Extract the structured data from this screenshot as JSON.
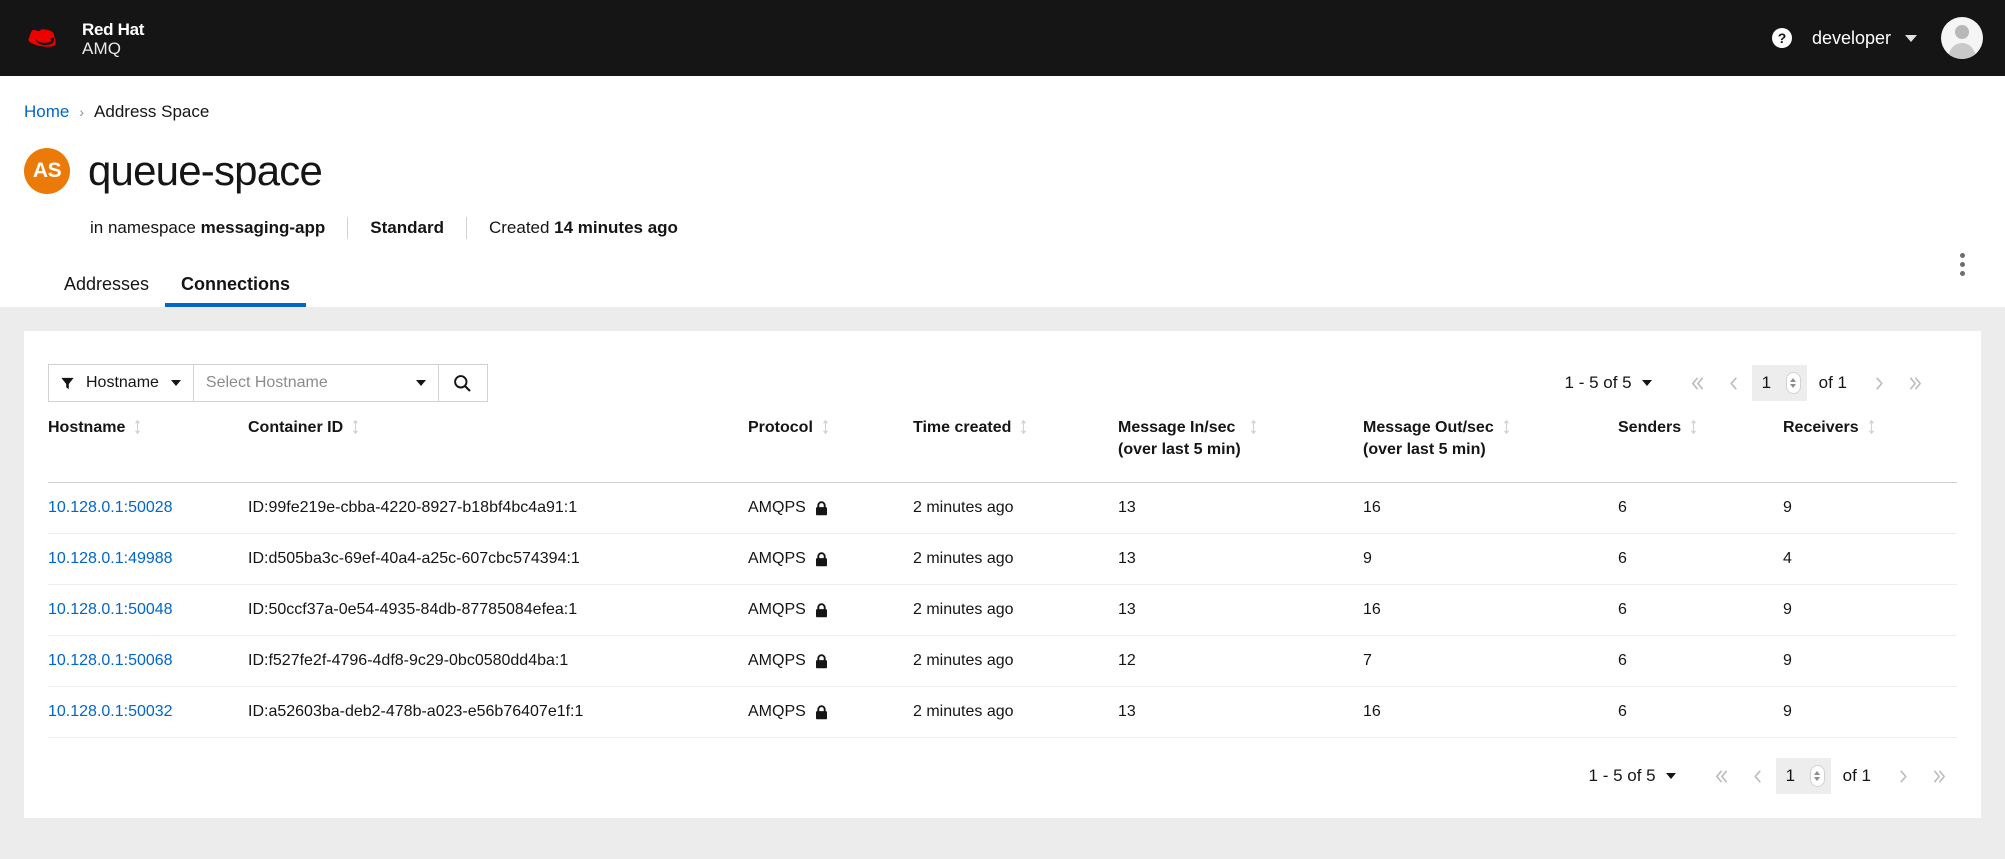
{
  "masthead": {
    "brand_line1": "Red Hat",
    "brand_line2": "AMQ",
    "help_icon": "question-circle-icon",
    "user_name": "developer",
    "avatar_icon": "user-avatar-icon"
  },
  "breadcrumb": {
    "home": "Home",
    "separator": "›",
    "current": "Address Space"
  },
  "page": {
    "badge": "AS",
    "title": "queue-space",
    "kebab_icon": "vertical-kebab-icon",
    "meta": {
      "namespace_prefix": "in namespace ",
      "namespace": "messaging-app",
      "plan": "Standard",
      "created_prefix": "Created ",
      "created": "14 minutes ago"
    }
  },
  "tabs": [
    {
      "label": "Addresses",
      "active": false
    },
    {
      "label": "Connections",
      "active": true
    }
  ],
  "toolbar": {
    "filter_icon": "filter-funnel-icon",
    "filter_label": "Hostname",
    "filter_caret_icon": "caret-down-icon",
    "typeahead_placeholder": "Select Hostname",
    "typeahead_value": "",
    "typeahead_caret_icon": "caret-down-icon",
    "search_icon": "search-icon"
  },
  "pagination": {
    "summary": "1 - 5 of 5",
    "summary_range": "1 - 5",
    "summary_total": "5",
    "summary_caret_icon": "caret-down-icon",
    "first_icon": "angle-double-left-icon",
    "prev_icon": "angle-left-icon",
    "page_value": "1",
    "spinner_icon": "number-spinner-icon",
    "of_label": "of 1",
    "next_icon": "angle-right-icon",
    "last_icon": "angle-double-right-icon"
  },
  "table": {
    "columns": [
      {
        "label": "Hostname",
        "sub": "",
        "sort_icon": "sort-icon"
      },
      {
        "label": "Container ID",
        "sub": "",
        "sort_icon": "sort-icon"
      },
      {
        "label": "Protocol",
        "sub": "",
        "sort_icon": "sort-icon"
      },
      {
        "label": "Time created",
        "sub": "",
        "sort_icon": "sort-icon"
      },
      {
        "label": "Message In/sec",
        "sub": "(over last 5 min)",
        "sort_icon": "sort-icon"
      },
      {
        "label": "Message Out/sec",
        "sub": "(over last 5 min)",
        "sort_icon": "sort-icon"
      },
      {
        "label": "Senders",
        "sub": "",
        "sort_icon": "sort-icon"
      },
      {
        "label": "Receivers",
        "sub": "",
        "sort_icon": "sort-icon"
      }
    ],
    "rows": [
      {
        "hostname": "10.128.0.1:50028",
        "container_id": "ID:99fe219e-cbba-4220-8927-b18bf4bc4a91:1",
        "protocol": "AMQPS",
        "protocol_icon": "lock-icon",
        "time_created": "2 minutes ago",
        "message_in": "13",
        "message_out": "16",
        "senders": "6",
        "receivers": "9"
      },
      {
        "hostname": "10.128.0.1:49988",
        "container_id": "ID:d505ba3c-69ef-40a4-a25c-607cbc574394:1",
        "protocol": "AMQPS",
        "protocol_icon": "lock-icon",
        "time_created": "2 minutes ago",
        "message_in": "13",
        "message_out": "9",
        "senders": "6",
        "receivers": "4"
      },
      {
        "hostname": "10.128.0.1:50048",
        "container_id": "ID:50ccf37a-0e54-4935-84db-87785084efea:1",
        "protocol": "AMQPS",
        "protocol_icon": "lock-icon",
        "time_created": "2 minutes ago",
        "message_in": "13",
        "message_out": "16",
        "senders": "6",
        "receivers": "9"
      },
      {
        "hostname": "10.128.0.1:50068",
        "container_id": "ID:f527fe2f-4796-4df8-9c29-0bc0580dd4ba:1",
        "protocol": "AMQPS",
        "protocol_icon": "lock-icon",
        "time_created": "2 minutes ago",
        "message_in": "12",
        "message_out": "7",
        "senders": "6",
        "receivers": "9"
      },
      {
        "hostname": "10.128.0.1:50032",
        "container_id": "ID:a52603ba-deb2-478b-a023-e56b76407e1f:1",
        "protocol": "AMQPS",
        "protocol_icon": "lock-icon",
        "time_created": "2 minutes ago",
        "message_in": "13",
        "message_out": "16",
        "senders": "6",
        "receivers": "9"
      }
    ]
  },
  "colors": {
    "masthead_bg": "#151515",
    "brand_red": "#ee0000",
    "link_blue": "#0066cc",
    "accent_orange": "#ec7a08",
    "page_bg": "#ececec",
    "border": "#d2d2d2"
  }
}
